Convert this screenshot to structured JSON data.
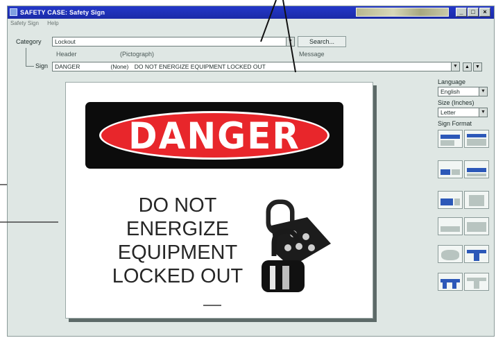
{
  "window": {
    "title": "SAFETY CASE: Safety Sign",
    "menu": [
      "Safety Sign",
      "Help"
    ]
  },
  "form": {
    "category_label": "Category",
    "category_value": "Lockout",
    "search_label": "Search...",
    "header_label": "Header",
    "pictograph_label": "(Pictograph)",
    "message_label": "Message",
    "sign_label": "Sign",
    "sign_header": "DANGER",
    "sign_pictograph": "(None)",
    "sign_message": "DO NOT ENERGIZE EQUIPMENT LOCKED OUT"
  },
  "sign": {
    "header": "DANGER",
    "lines": [
      "DO NOT",
      "ENERGIZE",
      "EQUIPMENT",
      "LOCKED OUT"
    ]
  },
  "panel": {
    "language_label": "Language",
    "language_value": "English",
    "size_label": "Size (Inches)",
    "size_value": "Letter",
    "format_label": "Sign Format"
  },
  "colors": {
    "danger_red": "#e8262b",
    "title_blue": "#1a2aa8",
    "band_black": "#0c0c0c"
  }
}
